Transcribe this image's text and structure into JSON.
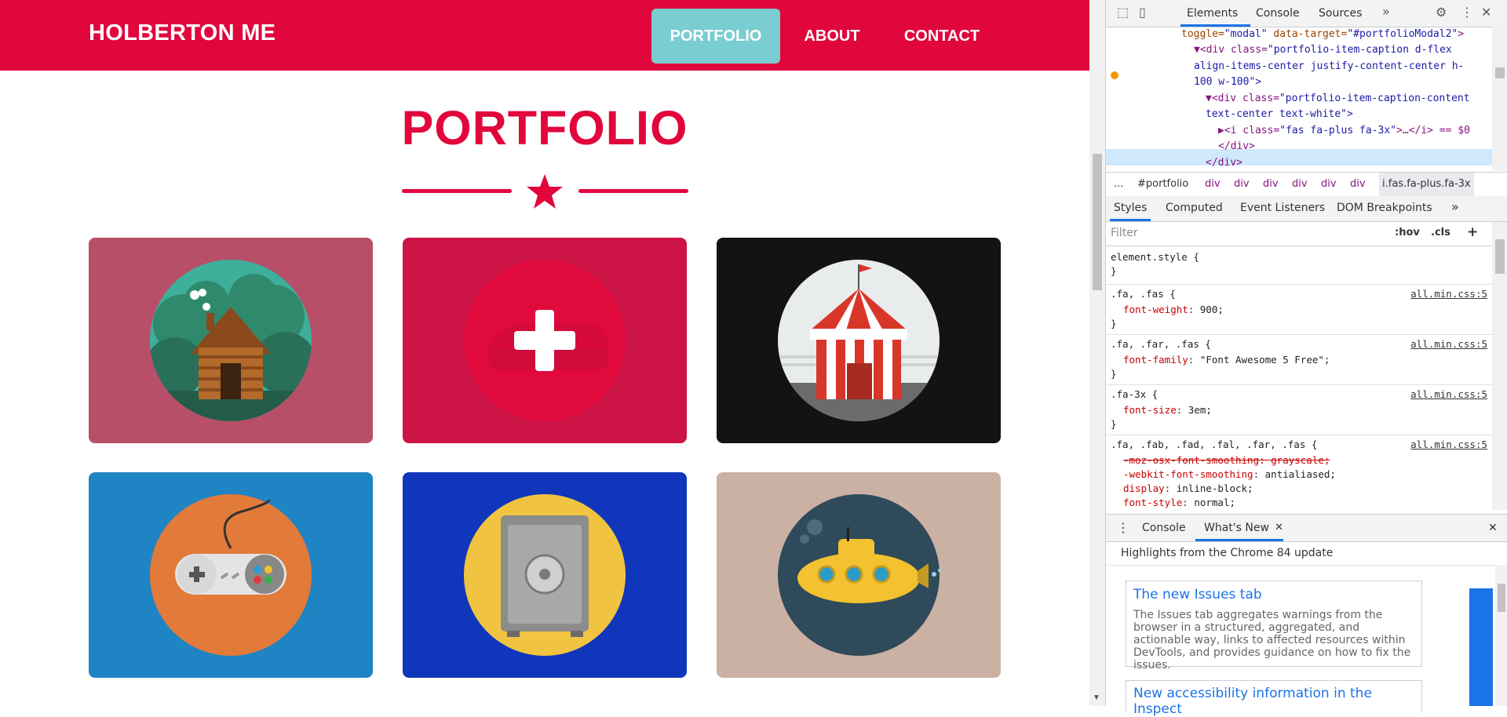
{
  "page": {
    "brand": "HOLBERTON ME",
    "nav": [
      {
        "label": "PORTFOLIO"
      },
      {
        "label": "ABOUT"
      },
      {
        "label": "CONTACT"
      }
    ],
    "section_title": "PORTFOLIO",
    "portfolio_items": [
      {
        "icon": "cabin",
        "background": "#b74f68"
      },
      {
        "icon": "plus-hover",
        "background": "#e10a3d"
      },
      {
        "icon": "circus-tent",
        "background": "#141213"
      },
      {
        "icon": "game-controller",
        "background": "#1f84c4"
      },
      {
        "icon": "safe",
        "background": "#1036bb"
      },
      {
        "icon": "submarine",
        "background": "#cbb1a3"
      }
    ],
    "colors": {
      "primary": "#e1063c",
      "active_nav": "#7acdd0"
    }
  },
  "devtools": {
    "tabs": [
      "Elements",
      "Console",
      "Sources"
    ],
    "active_tab": "Elements",
    "tree": [
      {
        "pre": "toggle=",
        "v1": "\"modal\"",
        "mid": " data-target=",
        "v2": "\"#portfolioModal2\"",
        "end": ">"
      },
      {
        "pre": "▼<div class=",
        "v1": "\"portfolio-item-caption d-flex"
      },
      {
        "text": "align-items-center justify-content-center h-"
      },
      {
        "text": "100 w-100\">"
      },
      {
        "pre": "▼<div class=",
        "v1": "\"portfolio-item-caption-content"
      },
      {
        "text": "text-center text-white\">"
      },
      {
        "pre": "▶<i class=",
        "v1": "\"fas fa-plus fa-3x\"",
        "end": ">…</i> == $0"
      },
      {
        "text": "</div>"
      },
      {
        "text": "</div>"
      }
    ],
    "breadcrumbs": [
      "...",
      "#portfolio",
      "div",
      "div",
      "div",
      "div",
      "div",
      "div",
      "i.fas.fa-plus.fa-3x"
    ],
    "sub_tabs": [
      "Styles",
      "Computed",
      "Event Listeners",
      "DOM Breakpoints"
    ],
    "filter_placeholder": "Filter",
    "filter_buttons": [
      ":hov",
      ".cls",
      "+"
    ],
    "rules": [
      {
        "selector": "element.style {",
        "props": [],
        "close": "}",
        "source": ""
      },
      {
        "selector": ".fa, .fas {",
        "props": [
          {
            "name": "font-weight",
            "value": "900;"
          }
        ],
        "close": "}",
        "source": "all.min.css:5"
      },
      {
        "selector": ".fa, .far, .fas {",
        "props": [
          {
            "name": "font-family",
            "value": "\"Font Awesome 5 Free\";"
          }
        ],
        "close": "}",
        "source": "all.min.css:5"
      },
      {
        "selector": ".fa-3x {",
        "props": [
          {
            "name": "font-size",
            "value": "3em;"
          }
        ],
        "close": "}",
        "source": "all.min.css:5"
      },
      {
        "selector": ".fa, .fab, .fad, .fal, .far, .fas {",
        "props": [
          {
            "name": "-moz-osx-font-smoothing",
            "value": "grayscale;",
            "struck": true
          },
          {
            "name": "-webkit-font-smoothing",
            "value": "antialiased;"
          },
          {
            "name": "display",
            "value": "inline-block;"
          },
          {
            "name": "font-style",
            "value": "normal;"
          }
        ],
        "close": "",
        "source": "all.min.css:5"
      }
    ],
    "drawer_tabs": [
      "Console",
      "What's New"
    ],
    "highlights": "Highlights from the Chrome 84 update",
    "news": [
      {
        "title": "The new Issues tab",
        "body": "The Issues tab aggregates warnings from the browser in a structured, aggregated, and actionable way, links to affected resources within DevTools, and provides guidance on how to fix the issues."
      },
      {
        "title": "New accessibility information in the Inspect",
        "body": ""
      }
    ]
  }
}
